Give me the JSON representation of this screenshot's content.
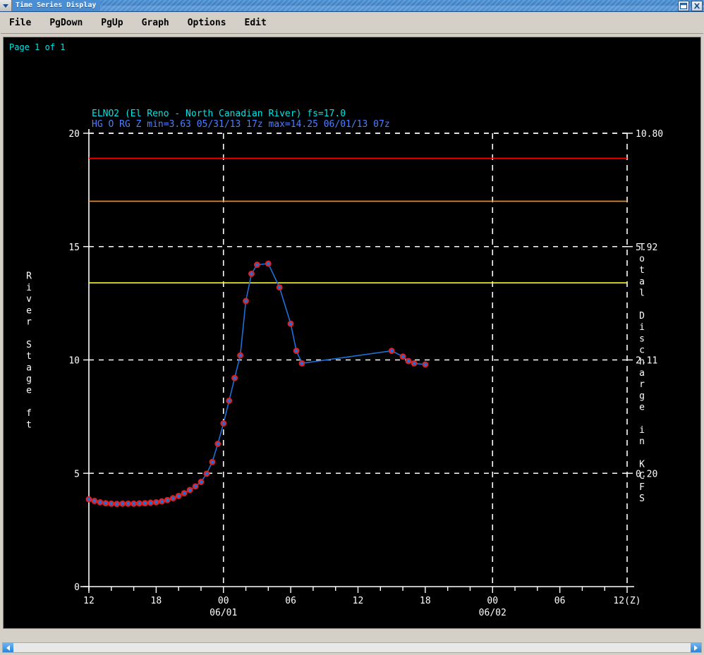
{
  "window": {
    "title": "Time Series Display",
    "menu_icon": "chevron-down-icon",
    "buttons": [
      {
        "name": "restore-button",
        "icon": "restore-icon"
      },
      {
        "name": "close-button",
        "icon": "close-icon"
      }
    ]
  },
  "menubar": {
    "items": [
      "File",
      "PgDown",
      "PgUp",
      "Graph",
      "Options",
      "Edit"
    ]
  },
  "page_label": "Page 1 of 1",
  "colors": {
    "background": "#000000",
    "axis": "#ffffff",
    "grid": "#ffffff",
    "title_line1": "#00e5e5",
    "title_line2": "#4f7fff",
    "series_line": "#1f6fd8",
    "marker_edge": "#e02020",
    "marker_fill": "#1f6fd8",
    "threshold_major": "#ff0000",
    "threshold_moderate": "#ff9000",
    "threshold_minor": "#ffff00"
  },
  "chart_data": {
    "type": "line",
    "title": "ELNO2 (El Reno - North Canadian River) fs=17.0",
    "subtitle": "HG O RG Z min=3.63 05/31/13 17z max=14.25 06/01/13 07z",
    "station_id": "ELNO2",
    "station_name": "El Reno - North Canadian River",
    "flood_stage_label": "fs=17.0",
    "pe_code": "HG O RG Z",
    "min_value": 3.63,
    "min_time": "05/31/13 17z",
    "max_value": 14.25,
    "max_time": "06/01/13 07z",
    "xlabel": "",
    "ylabel": "River Stage ft",
    "y2label": "Total Discharge in KCFS",
    "ylim": [
      0,
      20
    ],
    "yticks": [
      0,
      5,
      10,
      15,
      20
    ],
    "ytick_labels": [
      "0",
      "5",
      "10",
      "15",
      "20"
    ],
    "y2tick_labels": [
      "0.20",
      "2.11",
      "5.92",
      "10.80"
    ],
    "y2tick_at_stage": [
      5,
      10,
      15,
      20
    ],
    "xlim_hours": [
      0,
      24
    ],
    "xtick_labels": [
      "12",
      "18",
      "00",
      "06",
      "12",
      "18",
      "00",
      "06",
      "12(Z)"
    ],
    "xtick_hours": [
      0,
      3,
      6,
      9,
      12,
      15,
      18,
      21,
      24
    ],
    "xtick_day_labels": [
      {
        "at_hour": 6,
        "label": "06/01"
      },
      {
        "at_hour": 18,
        "label": "06/02"
      }
    ],
    "grid": true,
    "grid_style": "dashed",
    "gridlines_x_hours": [
      6,
      18
    ],
    "gridlines_y": [
      5,
      10,
      15,
      20
    ],
    "thresholds": [
      {
        "name": "major",
        "value": 18.9,
        "color": "#ff0000"
      },
      {
        "name": "moderate",
        "value": 17.0,
        "color": "#ff9000"
      },
      {
        "name": "minor",
        "value": 13.4,
        "color": "#ffff00"
      }
    ],
    "series": [
      {
        "name": "River Stage",
        "x": [
          0.0,
          0.25,
          0.5,
          0.75,
          1.0,
          1.25,
          1.5,
          1.75,
          2.0,
          2.25,
          2.5,
          2.75,
          3.0,
          3.25,
          3.5,
          3.75,
          4.0,
          4.25,
          4.5,
          4.75,
          5.0,
          5.25,
          5.5,
          5.75,
          6.0,
          6.25,
          6.5,
          6.75,
          7.0,
          7.25,
          7.5,
          8.0,
          8.5,
          9.0,
          9.25,
          9.5,
          13.5,
          14.0,
          14.25,
          14.5,
          15.0
        ],
        "y": [
          3.85,
          3.78,
          3.72,
          3.68,
          3.66,
          3.65,
          3.66,
          3.66,
          3.66,
          3.67,
          3.68,
          3.7,
          3.72,
          3.76,
          3.82,
          3.9,
          4.0,
          4.12,
          4.26,
          4.42,
          4.62,
          4.98,
          5.5,
          6.3,
          7.2,
          8.2,
          9.2,
          10.2,
          12.6,
          13.8,
          14.2,
          14.25,
          13.2,
          11.6,
          10.4,
          9.85,
          10.4,
          10.15,
          9.95,
          9.85,
          9.8
        ],
        "line_color": "#1f6fd8",
        "marker": "circle",
        "marker_edge": "#e02020",
        "marker_fill": "#1f6fd8"
      }
    ]
  }
}
